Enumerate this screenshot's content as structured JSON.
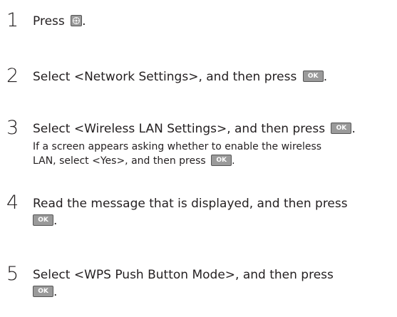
{
  "steps": [
    {
      "number": "1",
      "text": "Press",
      "key": "menu-icon",
      "after": "."
    },
    {
      "number": "2",
      "text": "Select <Network Settings>, and then press",
      "key": "OK",
      "after": "."
    },
    {
      "number": "3",
      "text": "Select <Wireless LAN Settings>, and then press",
      "key": "OK",
      "after": ".",
      "note_line1": "If a screen appears asking whether to enable the wireless",
      "note_line2_text": "LAN, select <Yes>, and then press",
      "note_key": "OK",
      "note_after": "."
    },
    {
      "number": "4",
      "text_line1": "Read the message that is displayed, and then press",
      "key": "OK",
      "after": "."
    },
    {
      "number": "5",
      "text_line1": "Select <WPS Push Button Mode>, and then press",
      "key": "OK",
      "after": "."
    }
  ],
  "colors": {
    "text": "#231f20",
    "key_fill": "#9a9a9a",
    "key_border": "#555555"
  }
}
